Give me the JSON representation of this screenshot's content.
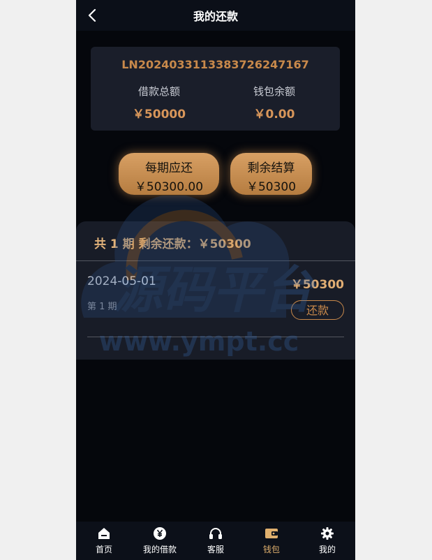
{
  "header": {
    "title": "我的还款"
  },
  "loan": {
    "number": "LN2024033113383726247167",
    "total_label": "借款总额",
    "total_value": "￥50000",
    "wallet_label": "钱包余额",
    "wallet_value": "￥0.00"
  },
  "actions": {
    "per_period_label": "每期应还",
    "per_period_value": "￥50300.00",
    "settle_label": "剩余结算",
    "settle_value": "￥50300"
  },
  "summary": {
    "text": "共 1 期  剩余还款：￥50300"
  },
  "periods": [
    {
      "date": "2024-05-01",
      "amount": "￥50300",
      "label": "第 1 期",
      "button": "还款"
    }
  ],
  "watermark": {
    "text": "源码平台",
    "url": "www.ympt.cc"
  },
  "tabbar": {
    "items": [
      {
        "label": "首页",
        "icon": "home-icon"
      },
      {
        "label": "我的借款",
        "icon": "yen-icon"
      },
      {
        "label": "客服",
        "icon": "headset-icon"
      },
      {
        "label": "钱包",
        "icon": "wallet-icon"
      },
      {
        "label": "我的",
        "icon": "gear-icon"
      }
    ],
    "active_index": 3
  },
  "colors": {
    "accent": "#d8965a",
    "background": "#05070c",
    "card": "#1a1e2a"
  }
}
